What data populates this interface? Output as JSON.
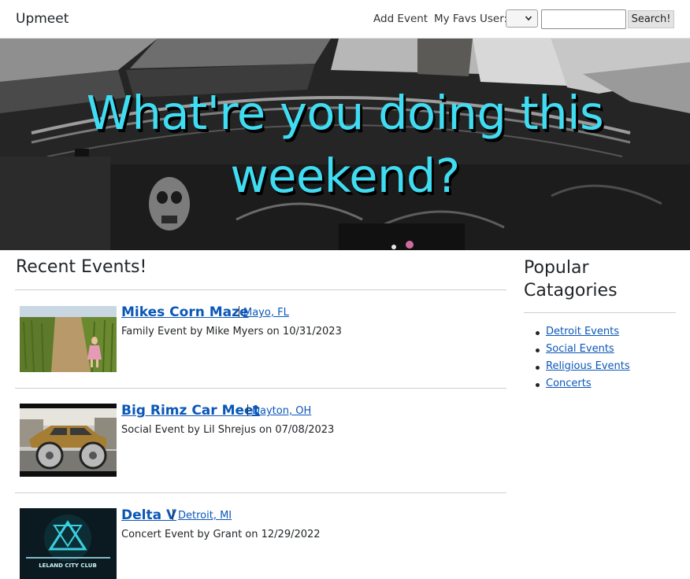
{
  "navbar": {
    "brand": "Upmeet",
    "add_event": "Add Event",
    "my_favs": "My Favs",
    "user_label": "User:",
    "user_select_value": "",
    "search_value": "",
    "search_button": "Search!"
  },
  "hero": {
    "title_line1": "What're you doing this",
    "title_line2": "weekend?",
    "title_color": "#3fdcf2"
  },
  "main": {
    "heading": "Recent Events!",
    "events": [
      {
        "title": "Mikes Corn Maze",
        "location": "Mayo, FL",
        "description": "Family Event by Mike Myers on 10/31/2023",
        "thumb": "corn-maze-photo"
      },
      {
        "title": "Big Rimz Car Meet",
        "location": "Dayton, OH",
        "description": "Social Event by Lil Shrejus on 07/08/2023",
        "thumb": "car-photo"
      },
      {
        "title": "Delta V",
        "location": "Detroit, MI",
        "description": "Concert Event by Grant on 12/29/2022",
        "thumb": "concert-poster",
        "poster_text_1": "LELAND CITY CLUB"
      }
    ]
  },
  "sidebar": {
    "heading": "Popular Catagories",
    "categories": [
      "Detroit Events",
      "Social Events",
      "Religious Events",
      "Concerts"
    ]
  },
  "colors": {
    "link": "#0b57b8",
    "text": "#212529"
  }
}
